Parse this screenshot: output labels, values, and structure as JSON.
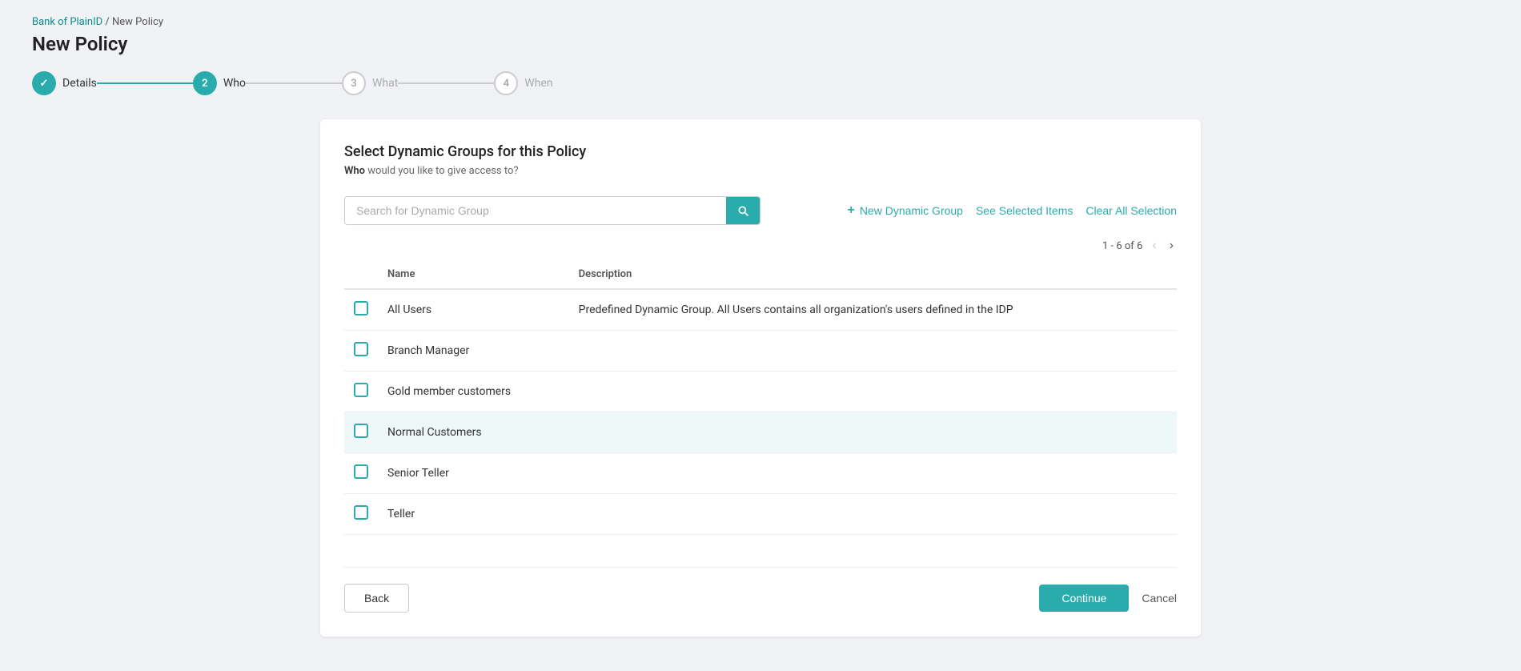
{
  "breadcrumb": {
    "parent": "Bank of PlainID",
    "separator": "/",
    "current": "New Policy"
  },
  "page": {
    "title": "New Policy"
  },
  "stepper": {
    "steps": [
      {
        "id": "details",
        "number": "✓",
        "label": "Details",
        "state": "completed"
      },
      {
        "id": "who",
        "number": "2",
        "label": "Who",
        "state": "active"
      },
      {
        "id": "what",
        "number": "3",
        "label": "What",
        "state": "inactive"
      },
      {
        "id": "when",
        "number": "4",
        "label": "When",
        "state": "inactive"
      }
    ]
  },
  "card": {
    "title": "Select Dynamic Groups for this Policy",
    "subtitle_prefix": "Who",
    "subtitle_suffix": " would you like to give access to?"
  },
  "toolbar": {
    "search_placeholder": "Search for Dynamic Group",
    "new_group_label": "New Dynamic Group",
    "see_selected_label": "See Selected Items",
    "clear_selection_label": "Clear All Selection"
  },
  "pagination": {
    "label": "1 - 6 of 6"
  },
  "table": {
    "columns": [
      {
        "id": "checkbox",
        "label": ""
      },
      {
        "id": "name",
        "label": "Name"
      },
      {
        "id": "description",
        "label": "Description"
      }
    ],
    "rows": [
      {
        "id": "all-users",
        "name": "All Users",
        "description": "Predefined Dynamic Group. All Users contains all organization's users defined in the IDP",
        "checked": false,
        "hovered": false
      },
      {
        "id": "branch-manager",
        "name": "Branch Manager",
        "description": "",
        "checked": false,
        "hovered": false
      },
      {
        "id": "gold-member",
        "name": "Gold member customers",
        "description": "",
        "checked": false,
        "hovered": false
      },
      {
        "id": "normal-customers",
        "name": "Normal Customers",
        "description": "",
        "checked": false,
        "hovered": true
      },
      {
        "id": "senior-teller",
        "name": "Senior Teller",
        "description": "",
        "checked": false,
        "hovered": false
      },
      {
        "id": "teller",
        "name": "Teller",
        "description": "",
        "checked": false,
        "hovered": false
      }
    ]
  },
  "footer": {
    "back_label": "Back",
    "continue_label": "Continue",
    "cancel_label": "Cancel"
  }
}
